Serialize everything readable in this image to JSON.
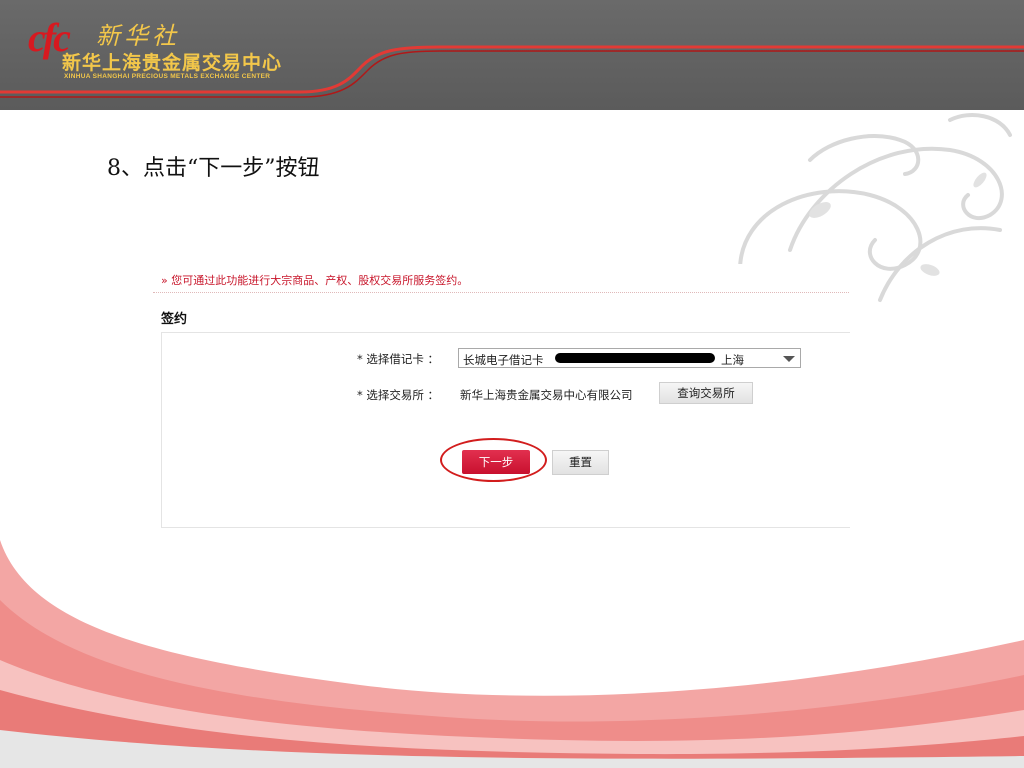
{
  "banner": {
    "logo_mark": "cfc",
    "logo_xinhua": "新华社",
    "logo_name_cn": "新华上海贵金属交易中心",
    "logo_name_en": "XINHUA SHANGHAI PRECIOUS METALS EXCHANGE CENTER"
  },
  "slide": {
    "step_title": "8、点击“下一步”按钮"
  },
  "panel": {
    "notice": "您可通过此功能进行大宗商品、产权、股权交易所服务签约。",
    "section_title": "签约",
    "card_label": "* 选择借记卡 ：",
    "card_value_prefix": "长城电子借记卡",
    "card_value_suffix": "上海",
    "exchange_label": "* 选择交易所 ：",
    "exchange_value": "新华上海贵金属交易中心有限公司",
    "query_button": "查询交易所",
    "next_button": "下一步",
    "reset_button": "重置"
  },
  "colors": {
    "banner_gray": "#5b5b5b",
    "brand_red": "#d71920",
    "logo_gold": "#f3c74a",
    "notice_red": "#c8162b",
    "primary_button": "#c8102e"
  },
  "icons": {
    "notice": "double-chevron-right-icon",
    "select": "caret-down-icon"
  }
}
